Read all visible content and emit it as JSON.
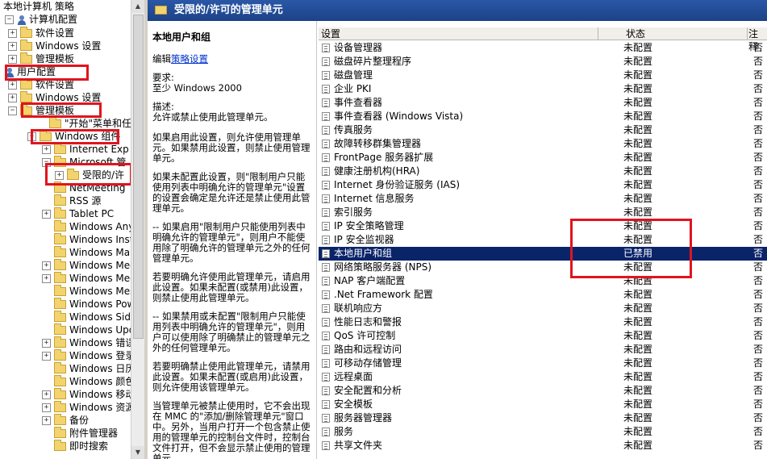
{
  "tree": {
    "root": "本地计算机 策略",
    "computer_config": "计算机配置",
    "software_settings": "软件设置",
    "windows_settings": "Windows 设置",
    "admin_templates": "管理模板",
    "user_config": "用户配置",
    "user_software_settings": "软件设置",
    "user_windows_settings": "Windows 设置",
    "user_admin_templates": "管理模板",
    "children": [
      "\"开始\"菜单和任",
      "Windows 组件",
      "Internet Exp",
      "Microsoft 管",
      "受限的/许",
      "NetMeeting",
      "RSS 源",
      "Tablet PC",
      "Windows Anyt",
      "Windows Inst",
      "Windows Mail",
      "Windows Medi",
      "Windows Medi",
      "Windows Mess",
      "Windows Powe",
      "Windows Side",
      "Windows Upda",
      "Windows 错误",
      "Windows 登录",
      "Windows 日历",
      "Windows 颜色",
      "Windows 移动",
      "Windows 资源",
      "备份",
      "附件管理器",
      "即时搜索"
    ]
  },
  "header": {
    "title": "受限的/许可的管理单元"
  },
  "description": {
    "title": "本地用户和组",
    "edit_prefix": "编辑",
    "edit_link": "策略设置",
    "req_label": "要求:",
    "req_value": "至少 Windows 2000",
    "desc_label": "描述:",
    "paragraphs": [
      "允许或禁止使用此管理单元。",
      "如果启用此设置，则允许使用管理单元。如果禁用此设置，则禁止使用管理单元。",
      "如果未配置此设置，则\"限制用户只能使用列表中明确允许的管理单元\"设置的设置会确定是允许还是禁止使用此管理单元。",
      "-- 如果启用\"限制用户只能使用列表中明确允许的管理单元\"，则用户不能使用除了明确允许的管理单元之外的任何管理单元。",
      "若要明确允许使用此管理单元，请启用此设置。如果未配置(或禁用)此设置，则禁止使用此管理单元。",
      "-- 如果禁用或未配置\"限制用户只能使用列表中明确允许的管理单元\"，则用户可以使用除了明确禁止的管理单元之外的任何管理单元。",
      "若要明确禁止使用此管理单元，请禁用此设置。如果未配置(或启用)此设置，则允许使用该管理单元。",
      "当管理单元被禁止使用时，它不会出现在 MMC 的\"添加/删除管理单元\"窗口中。另外，当用户打开一个包含禁止使用的管理单元的控制台文件时，控制台文件打开，但不会显示禁止使用的管理单元。"
    ]
  },
  "list": {
    "col_setting": "设置",
    "col_state": "状态",
    "col_comment": "注释",
    "rows": [
      {
        "name": "设备管理器",
        "state": "未配置",
        "comment": "否"
      },
      {
        "name": "磁盘碎片整理程序",
        "state": "未配置",
        "comment": "否"
      },
      {
        "name": "磁盘管理",
        "state": "未配置",
        "comment": "否"
      },
      {
        "name": "企业 PKI",
        "state": "未配置",
        "comment": "否"
      },
      {
        "name": "事件查看器",
        "state": "未配置",
        "comment": "否"
      },
      {
        "name": "事件查看器 (Windows Vista)",
        "state": "未配置",
        "comment": "否"
      },
      {
        "name": "传真服务",
        "state": "未配置",
        "comment": "否"
      },
      {
        "name": "故障转移群集管理器",
        "state": "未配置",
        "comment": "否"
      },
      {
        "name": "FrontPage 服务器扩展",
        "state": "未配置",
        "comment": "否"
      },
      {
        "name": "健康注册机构(HRA)",
        "state": "未配置",
        "comment": "否"
      },
      {
        "name": "Internet 身份验证服务 (IAS)",
        "state": "未配置",
        "comment": "否"
      },
      {
        "name": "Internet 信息服务",
        "state": "未配置",
        "comment": "否"
      },
      {
        "name": "索引服务",
        "state": "未配置",
        "comment": "否"
      },
      {
        "name": "IP 安全策略管理",
        "state": "未配置",
        "comment": "否"
      },
      {
        "name": "IP 安全监视器",
        "state": "未配置",
        "comment": "否"
      },
      {
        "name": "本地用户和组",
        "state": "已禁用",
        "comment": "否"
      },
      {
        "name": "网络策略服务器 (NPS)",
        "state": "未配置",
        "comment": "否"
      },
      {
        "name": "NAP 客户端配置",
        "state": "未配置",
        "comment": "否"
      },
      {
        "name": ".Net Framework 配置",
        "state": "未配置",
        "comment": "否"
      },
      {
        "name": "联机响应方",
        "state": "未配置",
        "comment": "否"
      },
      {
        "name": "性能日志和警报",
        "state": "未配置",
        "comment": "否"
      },
      {
        "name": "QoS 许可控制",
        "state": "未配置",
        "comment": "否"
      },
      {
        "name": "路由和远程访问",
        "state": "未配置",
        "comment": "否"
      },
      {
        "name": "可移动存储管理",
        "state": "未配置",
        "comment": "否"
      },
      {
        "name": "远程桌面",
        "state": "未配置",
        "comment": "否"
      },
      {
        "name": "安全配置和分析",
        "state": "未配置",
        "comment": "否"
      },
      {
        "name": "安全模板",
        "state": "未配置",
        "comment": "否"
      },
      {
        "name": "服务器管理器",
        "state": "未配置",
        "comment": "否"
      },
      {
        "name": "服务",
        "state": "未配置",
        "comment": "否"
      },
      {
        "name": "共享文件夹",
        "state": "未配置",
        "comment": "否"
      }
    ]
  },
  "colors": {
    "header_bg": "#1c4287",
    "selection_bg": "#0a246a",
    "annotation_red": "#e0141e",
    "link": "#0033cc"
  }
}
